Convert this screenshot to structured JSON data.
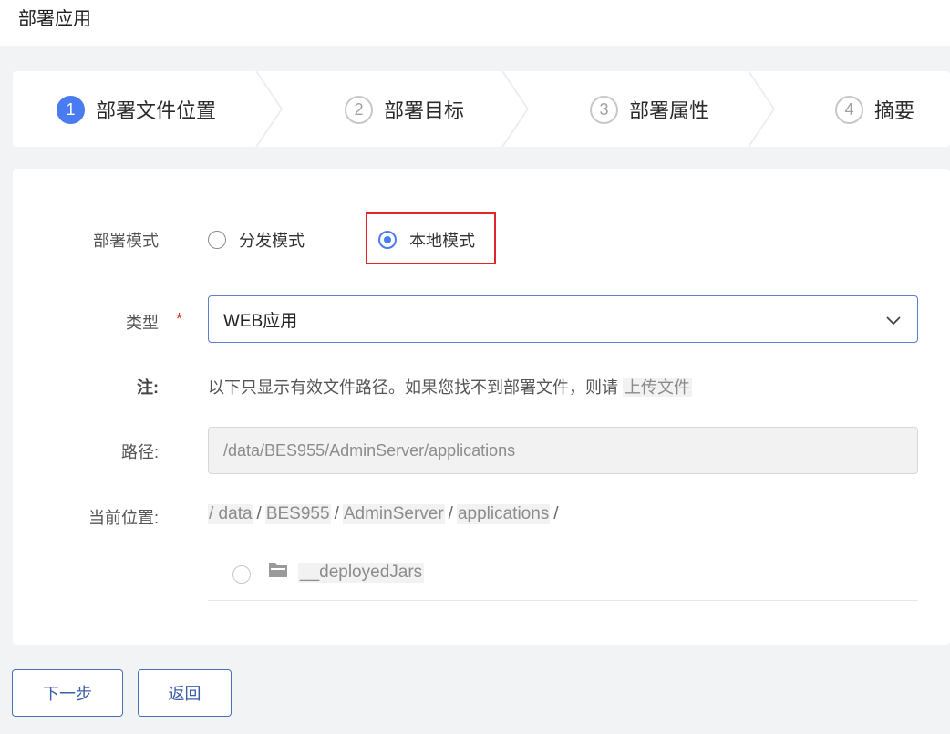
{
  "page": {
    "title": "部署应用"
  },
  "steps": [
    {
      "num": "1",
      "label": "部署文件位置",
      "active": true
    },
    {
      "num": "2",
      "label": "部署目标",
      "active": false
    },
    {
      "num": "3",
      "label": "部署属性",
      "active": false
    },
    {
      "num": "4",
      "label": "摘要",
      "active": false
    }
  ],
  "form": {
    "mode": {
      "label": "部署模式",
      "options": [
        {
          "label": "分发模式",
          "checked": false
        },
        {
          "label": "本地模式",
          "checked": true
        }
      ]
    },
    "type": {
      "label": "类型",
      "required_mark": "*",
      "value": "WEB应用"
    },
    "note": {
      "label": "注:",
      "text": "以下只显示有效文件路径。如果您找不到部署文件，则请",
      "link": "上传文件"
    },
    "path": {
      "label": "路径:",
      "value": "/data/BES955/AdminServer/applications"
    },
    "current_location": {
      "label": "当前位置:",
      "root": "/ data",
      "crumbs": [
        "BES955",
        "AdminServer",
        "applications"
      ],
      "separator": "/"
    },
    "files": [
      {
        "name": "__deployedJars",
        "icon": "folder-icon"
      }
    ]
  },
  "buttons": {
    "next": "下一步",
    "back": "返回"
  },
  "colors": {
    "accent": "#4a7bf0",
    "highlight": "#e0262b",
    "required": "#d0361e"
  }
}
